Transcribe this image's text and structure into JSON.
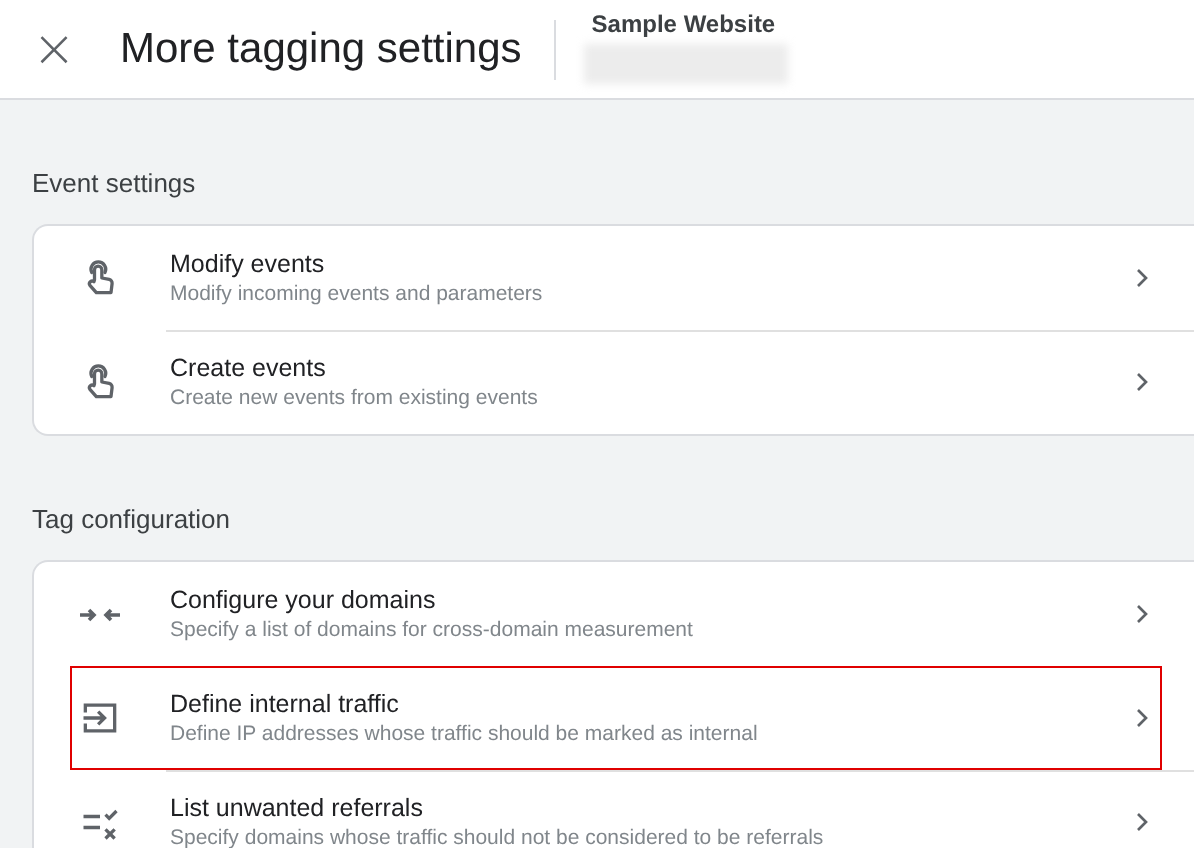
{
  "header": {
    "close_icon": "×",
    "title": "More tagging settings",
    "property_name": "Sample Website"
  },
  "sections": [
    {
      "title": "Event settings",
      "items": [
        {
          "kind": "touch",
          "title": "Modify events",
          "description": "Modify incoming events and parameters",
          "highlighted": false
        },
        {
          "kind": "touch",
          "title": "Create events",
          "description": "Create new events from existing events",
          "highlighted": false
        }
      ]
    },
    {
      "title": "Tag configuration",
      "items": [
        {
          "kind": "arrows",
          "title": "Configure your domains",
          "description": "Specify a list of domains for cross-domain measurement",
          "highlighted": false
        },
        {
          "kind": "enter",
          "title": "Define internal traffic",
          "description": "Define IP addresses whose traffic should be marked as internal",
          "highlighted": true
        },
        {
          "kind": "exclusion",
          "title": "List unwanted referrals",
          "description": "Specify domains whose traffic should not be considered to be referrals",
          "highlighted": false
        }
      ]
    }
  ]
}
